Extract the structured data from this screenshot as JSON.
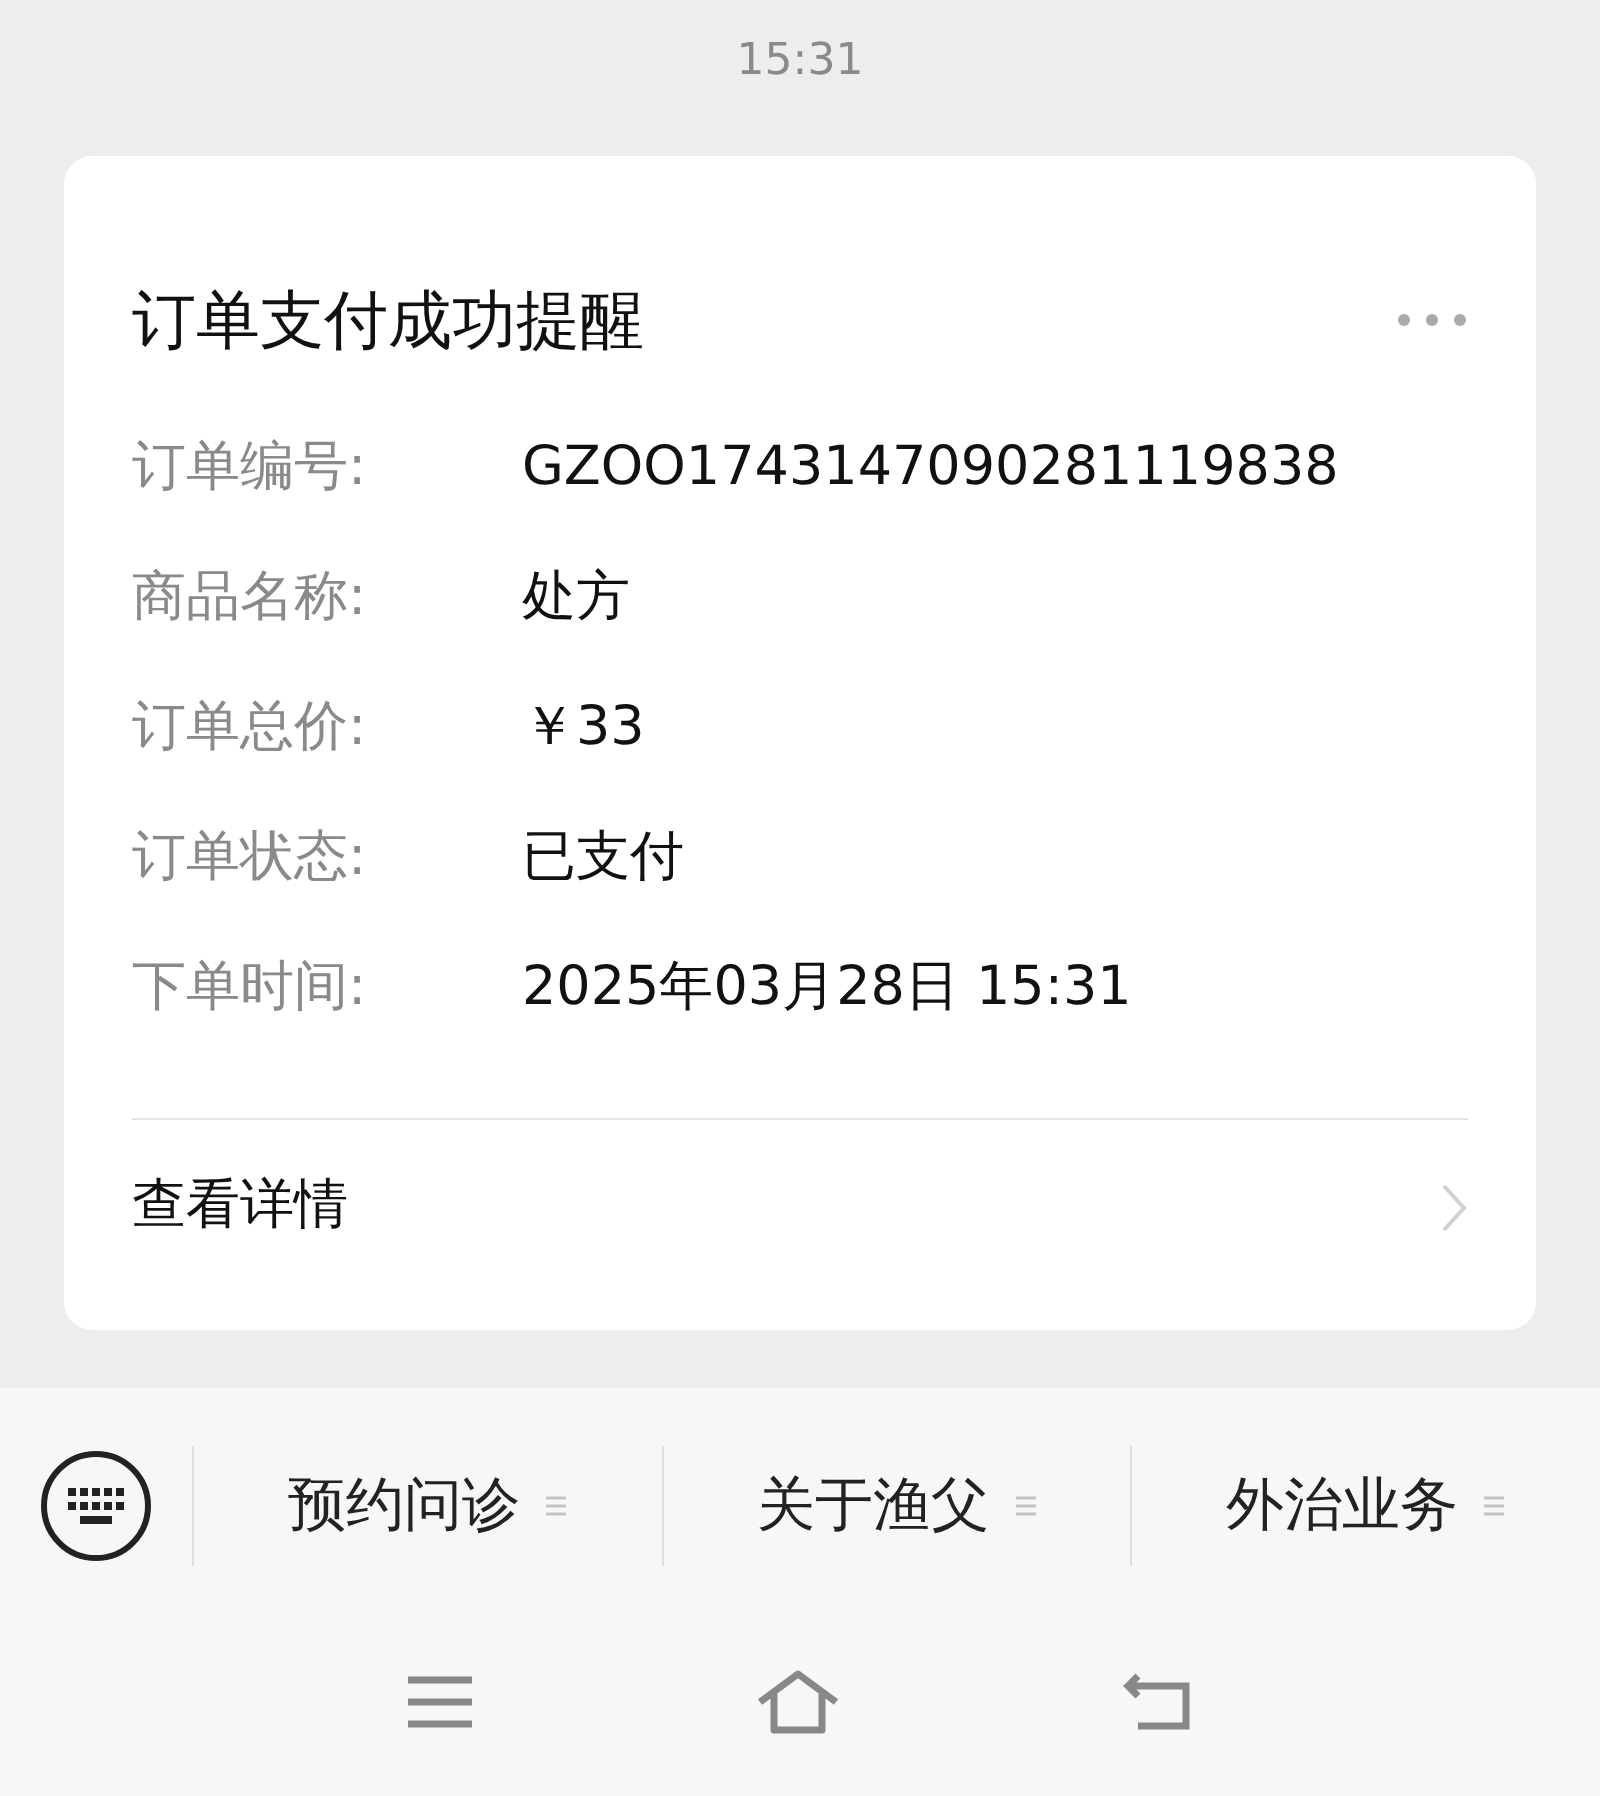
{
  "timestamp": "15:31",
  "card": {
    "title": "订单支付成功提醒",
    "fields": [
      {
        "label": "订单编号:",
        "value": "GZOO1743147090281119838"
      },
      {
        "label": "商品名称:",
        "value": "处方"
      },
      {
        "label": "订单总价:",
        "value": "￥33"
      },
      {
        "label": "订单状态:",
        "value": "已支付"
      },
      {
        "label": "下单时间:",
        "value": "2025年03月28日 15:31"
      }
    ],
    "details_link": "查看详情"
  },
  "menu": [
    "预约问诊",
    "关于渔父",
    "外治业务"
  ]
}
